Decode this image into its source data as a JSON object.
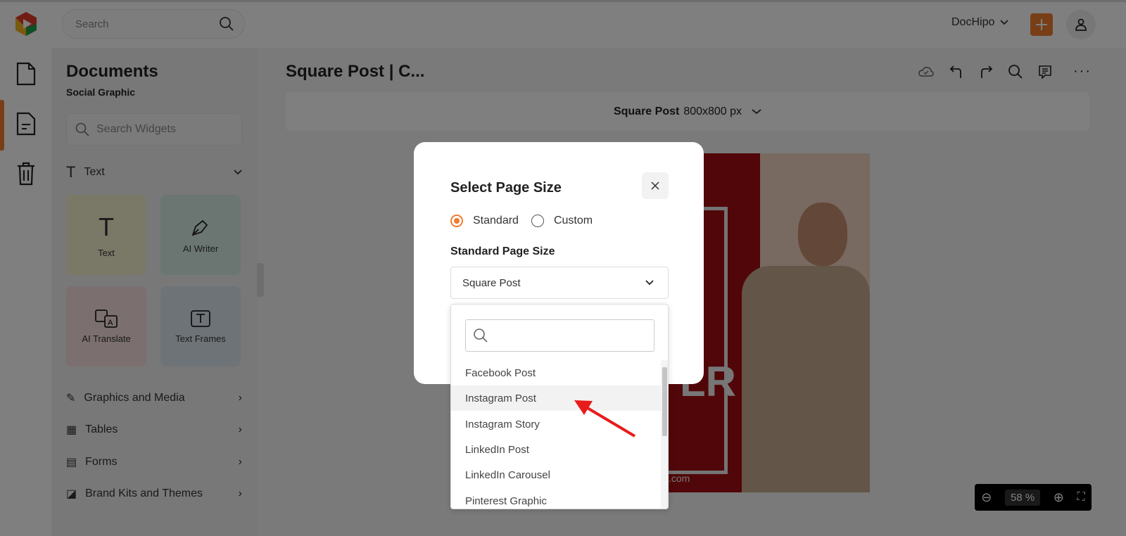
{
  "topbar": {
    "search_placeholder": "Search",
    "workspace": "DocHipo",
    "logo": "DocHipo"
  },
  "rail": {
    "items": [
      "document-icon",
      "document-text-icon",
      "trash-icon"
    ]
  },
  "sidebar": {
    "title": "Documents",
    "subtitle": "Social Graphic",
    "search_placeholder": "Search Widgets",
    "text_section": "Text",
    "cards": [
      {
        "label": "Text",
        "color": "#f5f0cf"
      },
      {
        "label": "AI Writer",
        "color": "#d6ece6"
      },
      {
        "label": "AI Translate",
        "color": "#f6dede"
      },
      {
        "label": "Text Frames",
        "color": "#dde6ef"
      }
    ],
    "items": [
      {
        "label": "Graphics and Media"
      },
      {
        "label": "Tables"
      },
      {
        "label": "Forms"
      },
      {
        "label": "Brand Kits and Themes"
      }
    ]
  },
  "editor": {
    "title": "Square Post | C...",
    "size_name": "Square Post",
    "size_dims": "800x800 px",
    "poster_text": "LR",
    "poster_url": ".com"
  },
  "zoom": {
    "value": "58",
    "unit": "%"
  },
  "modal": {
    "title": "Select Page Size",
    "radio_standard": "Standard",
    "radio_custom": "Custom",
    "selected_radio": "Standard",
    "field_label": "Standard Page Size",
    "selected_value": "Square Post",
    "dropdown": {
      "search_placeholder": "",
      "options": [
        "Facebook Post",
        "Instagram Post",
        "Instagram Story",
        "LinkedIn Post",
        "LinkedIn Carousel",
        "Pinterest Graphic"
      ],
      "highlighted": "Instagram Post"
    }
  },
  "colors": {
    "accent": "#f07c2e",
    "annotation_arrow": "#e81c1c",
    "poster_red": "#a30f12",
    "poster_beige": "#f1d3c2"
  }
}
